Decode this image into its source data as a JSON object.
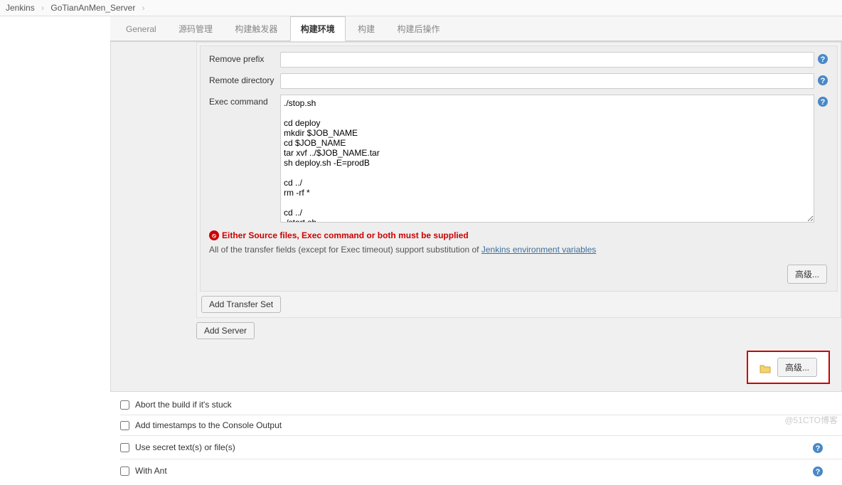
{
  "breadcrumb": {
    "items": [
      "Jenkins",
      "GoTianAnMen_Server"
    ]
  },
  "tabs": {
    "general": "General",
    "scm": "源码管理",
    "triggers": "构建触发器",
    "env": "构建环境",
    "build": "构建",
    "postbuild": "构建后操作"
  },
  "labels": {
    "removePrefix": "Remove prefix",
    "remoteDir": "Remote directory",
    "execCmd": "Exec command",
    "addTransfer": "Add Transfer Set",
    "addServer": "Add Server",
    "advanced": "高级..."
  },
  "fields": {
    "removePrefix": "",
    "remoteDir": "",
    "execCmd": "./stop.sh\n\ncd deploy\nmkdir $JOB_NAME\ncd $JOB_NAME\ntar xvf ../$JOB_NAME.tar\nsh deploy.sh -E=prodB\n\ncd ../\nrm -rf *\n\ncd ../\n./start.sh"
  },
  "error": "Either Source files, Exec command or both must be supplied",
  "helpPre": "All of the transfer fields (except for Exec timeout) support substitution of ",
  "helpLink": "Jenkins environment variables",
  "checks": {
    "abort": "Abort the build if it's stuck",
    "timestamps": "Add timestamps to the Console Output",
    "secret": "Use secret text(s) or file(s)",
    "withAnt": "With Ant"
  },
  "watermark": "@51CTO博客"
}
